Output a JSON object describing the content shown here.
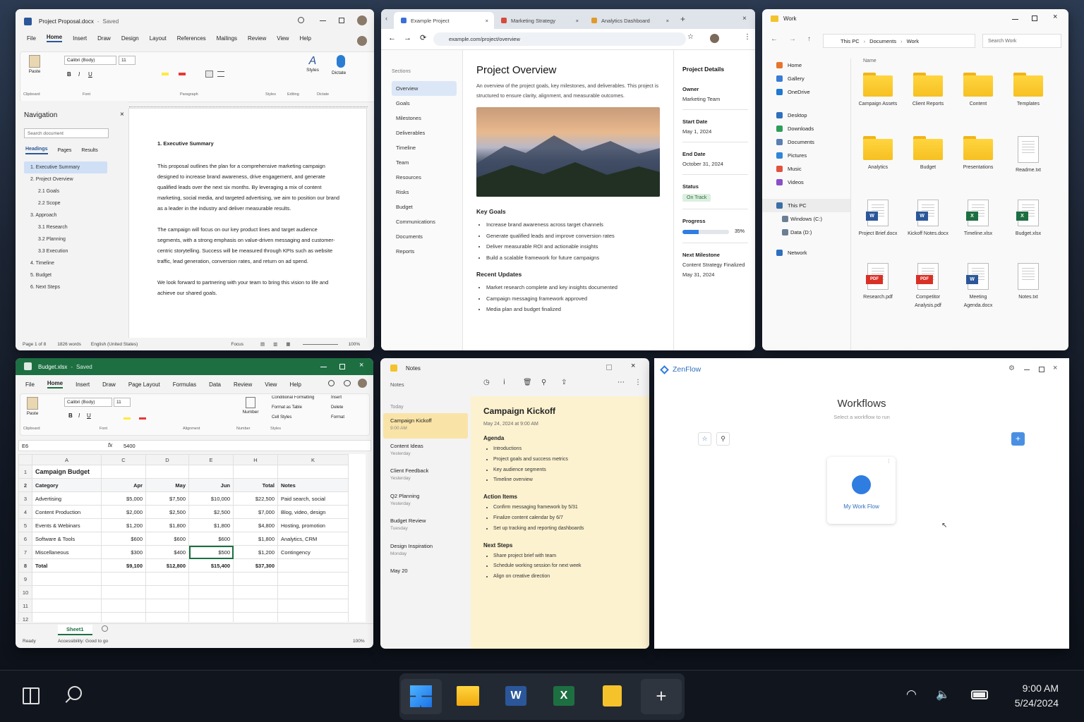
{
  "word": {
    "title": "Project Proposal.docx",
    "saved": "Saved",
    "menu": [
      "File",
      "Home",
      "Insert",
      "Draw",
      "Design",
      "Layout",
      "References",
      "Mailings",
      "Review",
      "View",
      "Help"
    ],
    "font": "Calibri (Body)",
    "size": "11",
    "groups": [
      "Clipboard",
      "Font",
      "Paragraph",
      "Styles",
      "Editing",
      "Dictate"
    ],
    "paste": "Paste",
    "styles": "Styles",
    "dictate": "Dictate",
    "nav_title": "Navigation",
    "search_ph": "Search document",
    "nav_tabs": [
      "Headings",
      "Pages",
      "Results"
    ],
    "headings": [
      {
        "t": "1. Executive Summary",
        "sub": false,
        "sel": true
      },
      {
        "t": "2. Project Overview",
        "sub": false
      },
      {
        "t": "2.1 Goals",
        "sub": true
      },
      {
        "t": "2.2 Scope",
        "sub": true
      },
      {
        "t": "3. Approach",
        "sub": false
      },
      {
        "t": "3.1 Research",
        "sub": true
      },
      {
        "t": "3.2 Planning",
        "sub": true
      },
      {
        "t": "3.3 Execution",
        "sub": true
      },
      {
        "t": "4. Timeline",
        "sub": false
      },
      {
        "t": "5. Budget",
        "sub": false
      },
      {
        "t": "6. Next Steps",
        "sub": false
      }
    ],
    "doc_heading": "1. Executive Summary",
    "paras": [
      "This proposal outlines the plan for a comprehensive marketing campaign designed to increase brand awareness, drive engagement, and generate qualified leads over the next six months. By leveraging a mix of content marketing, social media, and targeted advertising, we aim to position our brand as a leader in the industry and deliver measurable results.",
      "The campaign will focus on our key product lines and target audience segments, with a strong emphasis on value-driven messaging and customer-centric storytelling. Success will be measured through KPIs such as website traffic, lead generation, conversion rates, and return on ad spend.",
      "We look forward to partnering with your team to bring this vision to life and achieve our shared goals."
    ],
    "status": {
      "page": "Page 1 of 8",
      "words": "1826 words",
      "lang": "English (United States)",
      "focus": "Focus",
      "zoom": "100%"
    }
  },
  "browser": {
    "tabs": [
      "Example Project",
      "Marketing Strategy",
      "Analytics Dashboard"
    ],
    "url": "example.com/project/overview",
    "side_title": "Sections",
    "side": [
      "Overview",
      "Goals",
      "Milestones",
      "Deliverables",
      "Timeline",
      "Team",
      "Resources",
      "Risks",
      "Budget",
      "Communications",
      "Documents",
      "Reports"
    ],
    "h1": "Project Overview",
    "intro": "An overview of the project goals, key milestones, and deliverables. This project is structured to ensure clarity, alignment, and measurable outcomes.",
    "goals_title": "Key Goals",
    "goals": [
      "Increase brand awareness across target channels",
      "Generate qualified leads and improve conversion rates",
      "Deliver measurable ROI and actionable insights",
      "Build a scalable framework for future campaigns"
    ],
    "updates_title": "Recent Updates",
    "updates": [
      "Market research complete and key insights documented",
      "Campaign messaging framework approved",
      "Media plan and budget finalized"
    ],
    "details_title": "Project Details",
    "owner_l": "Owner",
    "owner": "Marketing Team",
    "start_l": "Start Date",
    "start": "May 1, 2024",
    "end_l": "End Date",
    "end": "October 31, 2024",
    "status_l": "Status",
    "status": "On Track",
    "progress_l": "Progress",
    "progress_pct": "35%",
    "progress_value": 35,
    "next_l": "Next Milestone",
    "next": "Content Strategy Finalized",
    "next_date": "May 31, 2024"
  },
  "explorer": {
    "title": "Work",
    "path": [
      "This PC",
      "Documents",
      "Work"
    ],
    "search_ph": "Search Work",
    "section": "Name",
    "side": [
      {
        "t": "Home",
        "c": "#e8742b"
      },
      {
        "t": "Gallery",
        "c": "#3a7bd5"
      },
      {
        "t": "OneDrive",
        "c": "#1f78d1"
      },
      {
        "t": "Desktop",
        "c": "#2f6fbf"
      },
      {
        "t": "Downloads",
        "c": "#2e9d5c"
      },
      {
        "t": "Documents",
        "c": "#5a7fb0"
      },
      {
        "t": "Pictures",
        "c": "#2f85d8"
      },
      {
        "t": "Music",
        "c": "#e0533f"
      },
      {
        "t": "Videos",
        "c": "#8a4fc8"
      },
      {
        "t": "This PC",
        "c": "#3b6ea5"
      },
      {
        "t": "Windows (C:)",
        "c": "#6b7f94"
      },
      {
        "t": "Data (D:)",
        "c": "#6b7f94"
      },
      {
        "t": "Network",
        "c": "#2f6fbf"
      }
    ],
    "items": [
      {
        "n": "Campaign Assets",
        "k": "folder"
      },
      {
        "n": "Client Reports",
        "k": "folder"
      },
      {
        "n": "Content",
        "k": "folder"
      },
      {
        "n": "Templates",
        "k": "folder"
      },
      {
        "n": "Analytics",
        "k": "folder"
      },
      {
        "n": "Budget",
        "k": "folder"
      },
      {
        "n": "Presentations",
        "k": "folder"
      },
      {
        "n": "Readme.txt",
        "k": "txt"
      },
      {
        "n": "Project Brief.docx",
        "k": "docx"
      },
      {
        "n": "Kickoff Notes.docx",
        "k": "docx"
      },
      {
        "n": "Timeline.xlsx",
        "k": "xlsx"
      },
      {
        "n": "Budget.xlsx",
        "k": "xlsx"
      },
      {
        "n": "Research.pdf",
        "k": "pdf"
      },
      {
        "n": "Competitor Analysis.pdf",
        "k": "pdf"
      },
      {
        "n": "Meeting Agenda.docx",
        "k": "docx"
      },
      {
        "n": "Notes.txt",
        "k": "txt"
      }
    ]
  },
  "excel": {
    "title": "Budget.xlsx",
    "saved": "Saved",
    "menu": [
      "File",
      "Home",
      "Insert",
      "Draw",
      "Page Layout",
      "Formulas",
      "Data",
      "Review",
      "View",
      "Help"
    ],
    "font": "Calibri (Body)",
    "size": "11",
    "groups": [
      "Clipboard",
      "Font",
      "Alignment",
      "Number",
      "Styles"
    ],
    "paste": "Paste",
    "number": "Number",
    "cond": "Conditional Formatting",
    "fmt_table": "Format as Table",
    "cell_styles": "Cell Styles",
    "insert": "Insert",
    "delete": "Delete",
    "format": "Format",
    "cell_ref": "E6",
    "formula": "5400",
    "cols": [
      "A",
      "C",
      "D",
      "E",
      "H",
      "K"
    ],
    "rows": [
      [
        "1",
        "Campaign Budget",
        "",
        "",
        "",
        "",
        ""
      ],
      [
        "2",
        "Category",
        "Apr",
        "May",
        "Jun",
        "Total",
        "Notes"
      ],
      [
        "3",
        "Advertising",
        "$5,000",
        "$7,500",
        "$10,000",
        "$22,500",
        "Paid search, social"
      ],
      [
        "4",
        "Content Production",
        "$2,000",
        "$2,500",
        "$2,500",
        "$7,000",
        "Blog, video, design"
      ],
      [
        "5",
        "Events & Webinars",
        "$1,200",
        "$1,800",
        "$1,800",
        "$4,800",
        "Hosting, promotion"
      ],
      [
        "6",
        "Software & Tools",
        "$600",
        "$600",
        "$600",
        "$1,800",
        "Analytics, CRM"
      ],
      [
        "7",
        "Miscellaneous",
        "$300",
        "$400",
        "$500",
        "$1,200",
        "Contingency"
      ],
      [
        "8",
        "Total",
        "$9,100",
        "$12,800",
        "$15,400",
        "$37,300",
        ""
      ],
      [
        "9",
        "",
        "",
        "",
        "",
        "",
        ""
      ],
      [
        "10",
        "",
        "",
        "",
        "",
        "",
        ""
      ],
      [
        "11",
        "",
        "",
        "",
        "",
        "",
        ""
      ],
      [
        "12",
        "",
        "",
        "",
        "",
        "",
        ""
      ]
    ],
    "sheet": "Sheet1",
    "ready": "Ready",
    "access": "Accessibility: Good to go",
    "zoom": "100%"
  },
  "notes": {
    "title": "Notes",
    "list_title": "Notes",
    "group": "Today",
    "items": [
      {
        "t": "Campaign Kickoff",
        "d": "9:00 AM",
        "sel": true
      },
      {
        "t": "Content Ideas",
        "d": "Yesterday"
      },
      {
        "t": "Client Feedback",
        "d": "Yesterday"
      },
      {
        "t": "Q2 Planning",
        "d": "Yesterday"
      },
      {
        "t": "Budget Review",
        "d": "Tuesday"
      },
      {
        "t": "Design Inspiration",
        "d": "Monday"
      },
      {
        "t": "May 20",
        "d": ""
      }
    ],
    "note_title": "Campaign Kickoff",
    "note_date": "May 24, 2024 at 9:00 AM",
    "agenda_t": "Agenda",
    "agenda": [
      "Introductions",
      "Project goals and success metrics",
      "Key audience segments",
      "Timeline overview"
    ],
    "actions_t": "Action Items",
    "actions": [
      "Confirm messaging framework by 5/31",
      "Finalize content calendar by 6/7",
      "Set up tracking and reporting dashboards"
    ],
    "next_t": "Next Steps",
    "next": [
      "Share project brief with team",
      "Schedule working session for next week",
      "Align on creative direction"
    ]
  },
  "zen": {
    "app": "ZenFlow",
    "title": "Workflows",
    "subtitle": "Select a workflow to run",
    "card": "My Work Flow",
    "add": "+"
  },
  "taskbar": {
    "time": "9:00 AM",
    "date": "5/24/2024"
  },
  "colors": {
    "word": "#2b579a",
    "excel": "#1d6f42",
    "accent": "#2f7de1",
    "status_ok": "#dcefe0"
  }
}
